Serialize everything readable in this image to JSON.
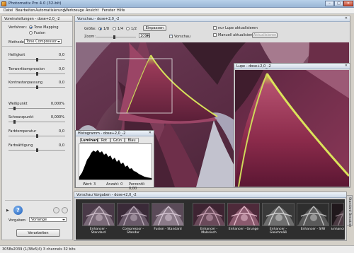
{
  "window": {
    "title": "Photomatix Pro 4.0 (32-bit)"
  },
  "menu": [
    "Datei",
    "Bearbeiten",
    "Automatisierung",
    "Werkzeuge",
    "Ansicht",
    "Fenster",
    "Hilfe"
  ],
  "settings": {
    "header": "Voreinstellungen - dose+2,0_-2",
    "method_label": "Verfahren:",
    "method_options": [
      "Tone Mapping",
      "Fusion"
    ],
    "methode_label": "Methode:",
    "methode_value": "Tone Compressor",
    "sliders": [
      {
        "label": "Helligkeit",
        "value": "0,0",
        "fraction": 0.5
      },
      {
        "label": "Tonwertkompression",
        "value": "0,0",
        "fraction": 0.5
      },
      {
        "label": "Kontrastanpassung",
        "value": "0,0",
        "fraction": 0.5
      },
      {
        "label": "Weißpunkt",
        "value": "0,000%",
        "fraction": 0.1
      },
      {
        "label": "Schwarzpunkt",
        "value": "0,000%",
        "fraction": 0.1
      },
      {
        "label": "Farbtemperatur",
        "value": "0,0",
        "fraction": 0.5
      },
      {
        "label": "Farbsättigung",
        "value": "0,0",
        "fraction": 0.5
      }
    ],
    "help_label": "?",
    "presets_label": "Vorgaben:",
    "presets_value": "Vorlange",
    "process_button": "Verarbeiten"
  },
  "preview": {
    "header": "Vorschau - dose+2,0_-2",
    "size_label": "Größe:",
    "size_options": [
      "1/8",
      "1/4",
      "1/2"
    ],
    "einpassen_button": "Einpassen",
    "zoom_label": "Zoom:",
    "zoom_value": "100%",
    "vorschau_label": "Vorschau",
    "lupe_update_label": "nur Lupe aktualisieren",
    "manual_update_label": "Manuell aktualisieren",
    "aktualisieren_button": "Aktualisieren"
  },
  "lupe": {
    "header": "Lupe - dose+2,0_-2"
  },
  "histogram": {
    "header": "Histogramm - dose+2,0_-2",
    "tabs": [
      "Luminanz",
      "Rot",
      "Grün",
      "Blau"
    ],
    "footer": [
      "Wert: 3",
      "Anzahl: 0",
      "Perzentil: 0,00"
    ]
  },
  "presets_panel": {
    "header": "Vorschau Vorgaben - dose+2,0_-2",
    "thumbs": [
      "Enhancer - Standard",
      "Compressor - Standar",
      "Fusion - Standard",
      "Enhancer - Malerisch",
      "Enhancer - Grunge",
      "Enhancer - Gleichmäß",
      "Enhancer - S/W",
      "Enhancer - Dunkel"
    ],
    "side_tabs": [
      "Standard",
      "Benutzer"
    ]
  },
  "status": {
    "text": "3058x2039 (1/38x5/4) 3 channels 32 bits"
  },
  "colors": {
    "accent": "#1a4f9a",
    "plant_rim": "#d7e25a",
    "plant_body": "#8a2a4a"
  }
}
